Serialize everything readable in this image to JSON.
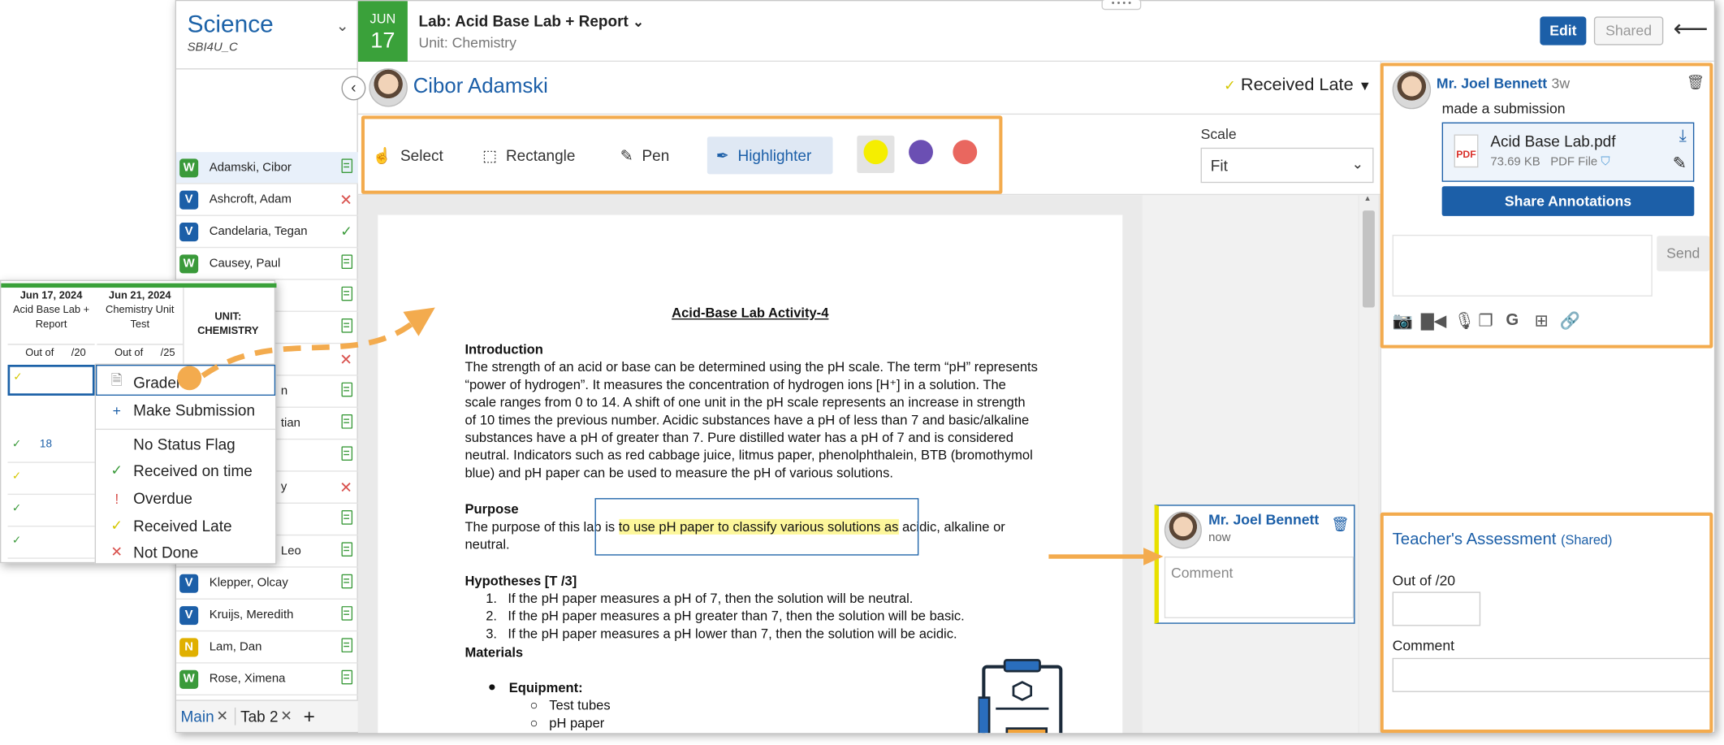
{
  "course": {
    "title": "Science",
    "code": "SBI4U_C"
  },
  "assignment": {
    "month": "JUN",
    "day": "17",
    "title": "Lab: Acid Base Lab + Report",
    "unit": "Unit: Chemistry"
  },
  "header_buttons": {
    "edit": "Edit",
    "shared": "Shared"
  },
  "students": [
    {
      "badge": "W",
      "name": "Adamski, Cibor",
      "status": "doc",
      "selected": true
    },
    {
      "badge": "V",
      "name": "Ashcroft, Adam",
      "status": "x"
    },
    {
      "badge": "V",
      "name": "Candelaria, Tegan",
      "status": "check"
    },
    {
      "badge": "W",
      "name": "Causey, Paul",
      "status": "doc"
    },
    {
      "badge": "",
      "name": "",
      "status": "doc"
    },
    {
      "badge": "",
      "name": "",
      "status": "doc"
    },
    {
      "badge": "",
      "name": "",
      "status": "x"
    },
    {
      "badge": "",
      "name": "n",
      "status": "doc"
    },
    {
      "badge": "",
      "name": "tian",
      "status": "doc"
    },
    {
      "badge": "",
      "name": "",
      "status": "doc"
    },
    {
      "badge": "",
      "name": "y",
      "status": "x"
    },
    {
      "badge": "",
      "name": "",
      "status": "doc"
    },
    {
      "badge": "",
      "name": "Leo",
      "status": "doc"
    },
    {
      "badge": "V",
      "name": "Klepper, Olcay",
      "status": "doc"
    },
    {
      "badge": "V",
      "name": "Kruijs, Meredith",
      "status": "doc"
    },
    {
      "badge": "N",
      "name": "Lam, Dan",
      "status": "doc"
    },
    {
      "badge": "W",
      "name": "Rose, Ximena",
      "status": "doc"
    }
  ],
  "tabs": [
    {
      "label": "Main"
    },
    {
      "label": "Tab 2"
    }
  ],
  "student_header": {
    "name": "Cibor Adamski",
    "status": "Received Late"
  },
  "toolbar": {
    "select": "Select",
    "rectangle": "Rectangle",
    "pen": "Pen",
    "highlighter": "Highlighter",
    "colors": [
      "#f5ee00",
      "#6b4fb3",
      "#e9675f"
    ]
  },
  "scale": {
    "label": "Scale",
    "value": "Fit"
  },
  "document": {
    "title": "Acid-Base Lab Activity-4",
    "intro_heading": "Introduction",
    "intro_lines": [
      "The strength of an acid or base can be determined using the pH scale. The term “pH” represents",
      "“power of hydrogen”. It measures the concentration of hydrogen ions [H⁺] in a solution. The",
      "scale ranges from 0 to 14. A shift of one unit in the pH scale represents an increase in strength",
      "of 10 times the previous number. Acidic substances have a pH of less than 7 and basic/alkaline",
      "substances have a pH of greater than 7. Pure distilled water has a pH of 7 and is considered",
      "neutral. Indicators such as red cabbage juice, litmus paper, phenolphthalein, BTB (bromothymol",
      "blue) and pH paper can be used to measure the pH of various solutions."
    ],
    "purpose_heading": "Purpose",
    "purpose_pre": "The purpose of this lab is ",
    "purpose_hl": "to use pH paper to classify various solutions as",
    "purpose_post": " acidic, alkaline or",
    "purpose_line2": "neutral.",
    "hypotheses_heading": "Hypotheses [T  /3]",
    "hypotheses": [
      "If the pH paper measures a pH of 7, then the solution will be neutral.",
      "If the pH paper measures a pH greater than 7, then the solution will be basic.",
      "If the pH paper measures a pH lower than 7, then the solution will be acidic."
    ],
    "materials_heading": "Materials",
    "equipment_heading": "Equipment:",
    "equipment": [
      "Test tubes",
      "pH paper"
    ]
  },
  "annotation_comment": {
    "author": "Mr. Joel Bennett",
    "time": "now",
    "placeholder": "Comment"
  },
  "submission": {
    "author": "Mr. Joel Bennett",
    "time": "3w",
    "text": "made a submission",
    "file_name": "Acid Base Lab.pdf",
    "file_size": "73.69 KB",
    "file_type": "PDF File",
    "pdf_label": "PDF",
    "share_button": "Share Annotations",
    "send_button": "Send"
  },
  "assessment": {
    "title": "Teacher's Assessment",
    "shared": "(Shared)",
    "out_of_label": "Out of",
    "out_of_value": "/20",
    "comment_label": "Comment"
  },
  "popup": {
    "col1": {
      "date": "Jun 17, 2024",
      "title": "Acid Base Lab + Report",
      "out_of": "Out of",
      "max": "/20"
    },
    "col2": {
      "date": "Jun 21, 2024",
      "title": "Chemistry Unit Test",
      "out_of": "Out of",
      "max": "/25"
    },
    "col3": {
      "title": "UNIT: CHEMISTRY"
    },
    "score": "18",
    "menu": [
      "Grader",
      "Make Submission",
      "No Status Flag",
      "Received on time",
      "Overdue",
      "Received Late",
      "Not Done"
    ]
  },
  "icons": {
    "colors": {
      "accent": "#1c5fa8",
      "highlight_box": "#f3ab4e",
      "green": "#3aa13a"
    }
  }
}
